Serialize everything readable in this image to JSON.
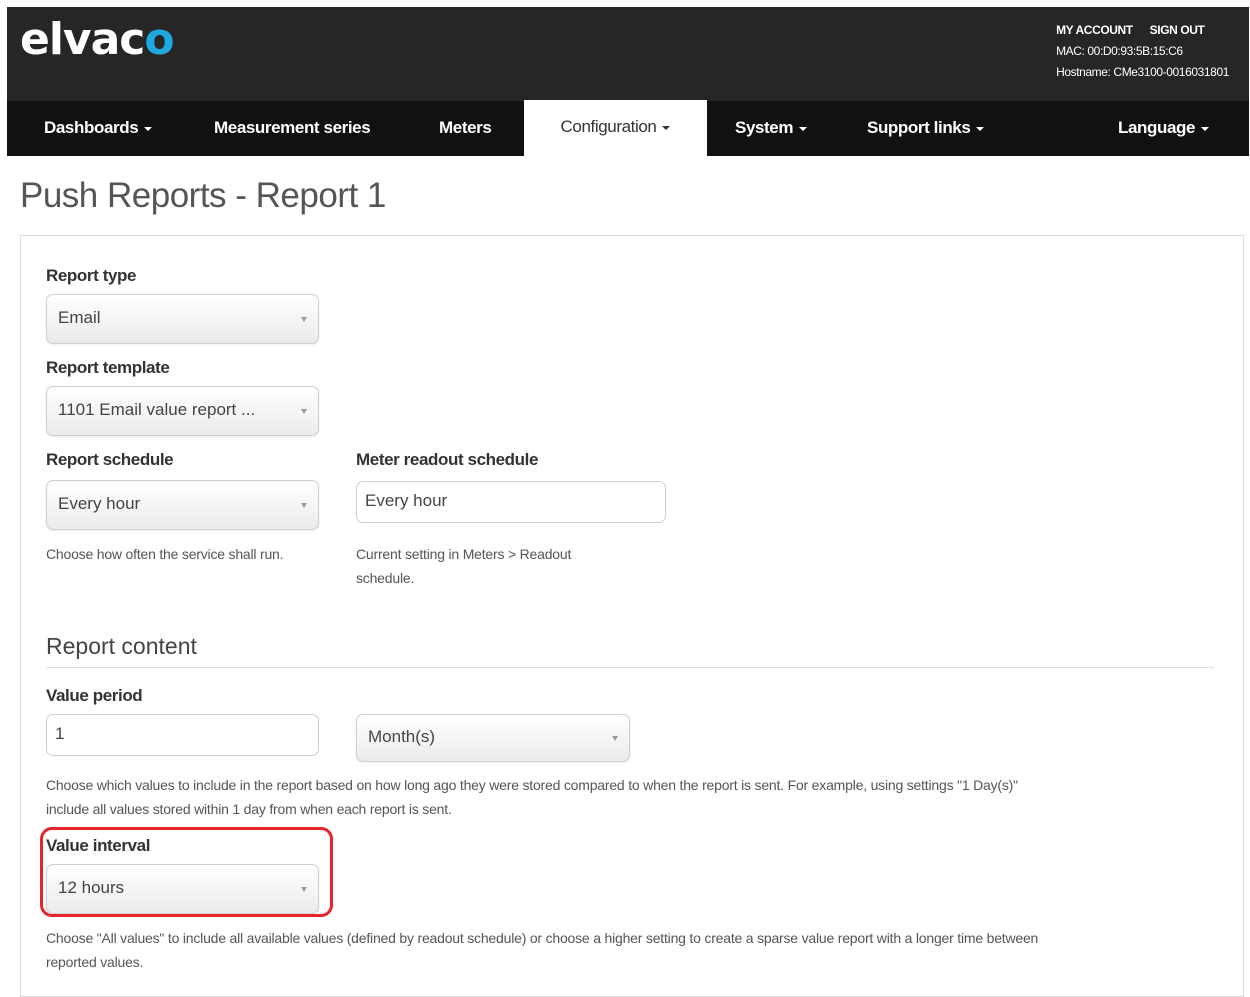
{
  "header": {
    "logo_main": "elvac",
    "logo_accent": "o",
    "my_account": "MY ACCOUNT",
    "sign_out": "SIGN OUT",
    "mac": "MAC: 00:D0:93:5B:15:C6",
    "hostname": "Hostname: CMe3100-0016031801"
  },
  "nav": {
    "items": [
      {
        "label": "Dashboards",
        "dropdown": true
      },
      {
        "label": "Measurement series",
        "dropdown": false
      },
      {
        "label": "Meters",
        "dropdown": false
      },
      {
        "label": "Configuration",
        "dropdown": true,
        "active": true
      },
      {
        "label": "System",
        "dropdown": true
      },
      {
        "label": "Support links",
        "dropdown": true
      },
      {
        "label": "Language",
        "dropdown": true
      }
    ]
  },
  "page": {
    "title": "Push Reports - Report 1"
  },
  "form": {
    "report_type": {
      "label": "Report type",
      "value": "Email"
    },
    "report_template": {
      "label": "Report template",
      "value": "1101 Email value report ..."
    },
    "report_schedule": {
      "label": "Report schedule",
      "value": "Every hour",
      "help": "Choose how often the service shall run."
    },
    "meter_readout_schedule": {
      "label": "Meter readout schedule",
      "value": "Every hour",
      "help_line1": "Current setting in Meters > Readout",
      "help_line2": "schedule."
    },
    "report_content": {
      "title": "Report content"
    },
    "value_period": {
      "label": "Value period",
      "amount": "1",
      "unit": "Month(s)",
      "help_line1": "Choose which values to include in the report based on how long ago they were stored compared to when the report is sent. For example, using settings \"1 Day(s)\"",
      "help_line2": "include all values stored within 1 day from when each report is sent."
    },
    "value_interval": {
      "label": "Value interval",
      "value": "12 hours",
      "help_line1": "Choose \"All values\" to include all available values (defined by readout schedule) or choose a higher setting to create a sparse value report with a longer time between",
      "help_line2": "reported values."
    }
  },
  "colors": {
    "header_bg": "#262626",
    "nav_bg": "#111111",
    "logo_accent": "#1fa8e0",
    "highlight": "#e5242c"
  }
}
